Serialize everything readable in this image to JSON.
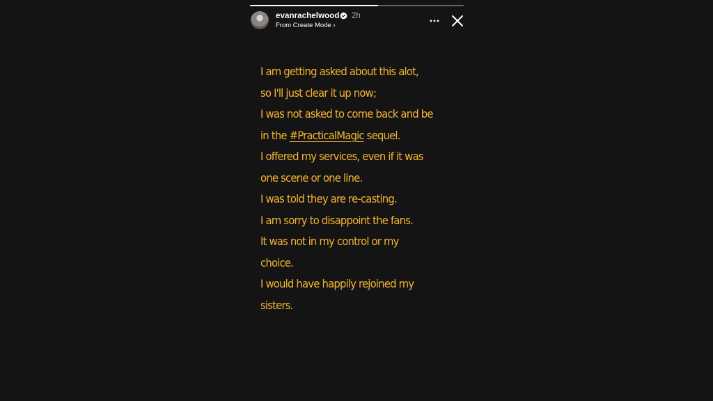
{
  "header": {
    "username": "evanrachelwood",
    "verified_icon": "verified-badge-icon",
    "time": "2h",
    "source_label": "From Create Mode ›",
    "more_icon": "more-horizontal-icon",
    "close_icon": "close-icon"
  },
  "progress": {
    "fraction": 0.6
  },
  "story": {
    "text_color": "#f3b332",
    "lines": [
      "I am getting asked about this alot,",
      "so I'll just clear it up now;",
      "I was not asked to come back and be",
      "in the",
      "#PracticalMagic",
      "sequel.",
      "I offered my services, even if it was",
      "one scene or one line.",
      "I was told they are re-casting.",
      "I am sorry to disappoint the fans.",
      "It was not in my control or my",
      "choice.",
      "I would have happily rejoined my",
      "sisters."
    ]
  }
}
